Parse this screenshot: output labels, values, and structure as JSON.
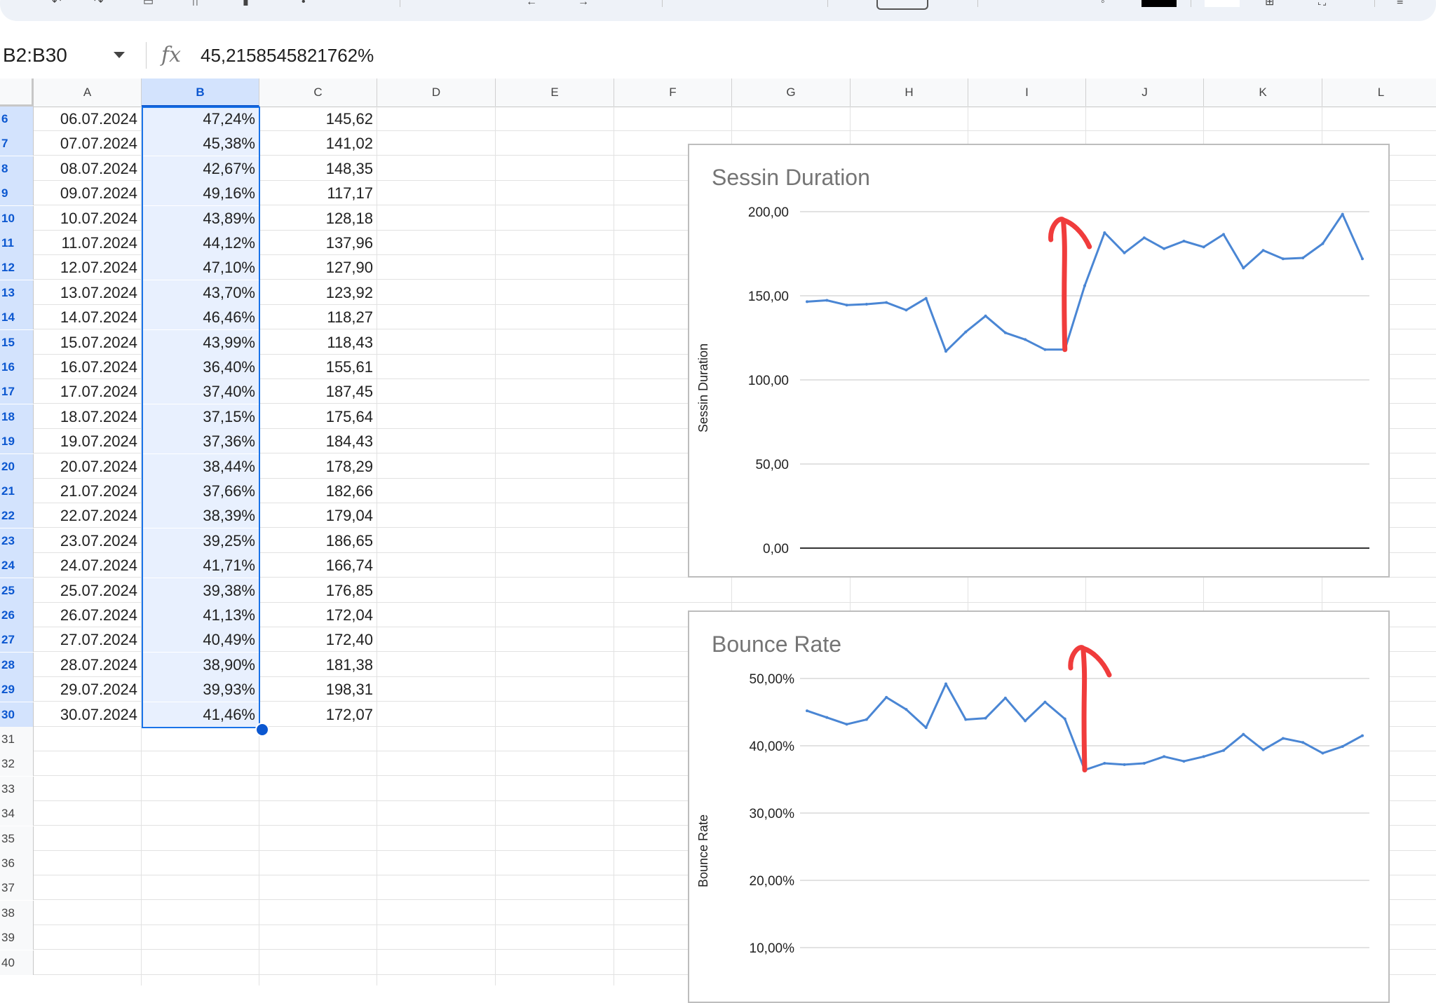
{
  "toolbar": {
    "icons": [
      "undo-icon",
      "redo-icon",
      "print-icon",
      "paint-format-icon",
      "zoom-icon",
      "borders-icon",
      "merge-icon"
    ]
  },
  "formula_bar": {
    "name_box": "B2:B30",
    "fx_label": "fx",
    "value": "45,2158545821762%"
  },
  "columns": [
    "A",
    "B",
    "C",
    "D",
    "E",
    "F",
    "G",
    "H",
    "I",
    "J",
    "K",
    "L"
  ],
  "rows": [
    {
      "num": "6",
      "a": "06.07.2024",
      "b": "47,24%",
      "c": "145,62"
    },
    {
      "num": "7",
      "a": "07.07.2024",
      "b": "45,38%",
      "c": "141,02"
    },
    {
      "num": "8",
      "a": "08.07.2024",
      "b": "42,67%",
      "c": "148,35"
    },
    {
      "num": "9",
      "a": "09.07.2024",
      "b": "49,16%",
      "c": "117,17"
    },
    {
      "num": "10",
      "a": "10.07.2024",
      "b": "43,89%",
      "c": "128,18"
    },
    {
      "num": "11",
      "a": "11.07.2024",
      "b": "44,12%",
      "c": "137,96"
    },
    {
      "num": "12",
      "a": "12.07.2024",
      "b": "47,10%",
      "c": "127,90"
    },
    {
      "num": "13",
      "a": "13.07.2024",
      "b": "43,70%",
      "c": "123,92"
    },
    {
      "num": "14",
      "a": "14.07.2024",
      "b": "46,46%",
      "c": "118,27"
    },
    {
      "num": "15",
      "a": "15.07.2024",
      "b": "43,99%",
      "c": "118,43"
    },
    {
      "num": "16",
      "a": "16.07.2024",
      "b": "36,40%",
      "c": "155,61"
    },
    {
      "num": "17",
      "a": "17.07.2024",
      "b": "37,40%",
      "c": "187,45"
    },
    {
      "num": "18",
      "a": "18.07.2024",
      "b": "37,15%",
      "c": "175,64"
    },
    {
      "num": "19",
      "a": "19.07.2024",
      "b": "37,36%",
      "c": "184,43"
    },
    {
      "num": "20",
      "a": "20.07.2024",
      "b": "38,44%",
      "c": "178,29"
    },
    {
      "num": "21",
      "a": "21.07.2024",
      "b": "37,66%",
      "c": "182,66"
    },
    {
      "num": "22",
      "a": "22.07.2024",
      "b": "38,39%",
      "c": "179,04"
    },
    {
      "num": "23",
      "a": "23.07.2024",
      "b": "39,25%",
      "c": "186,65"
    },
    {
      "num": "24",
      "a": "24.07.2024",
      "b": "41,71%",
      "c": "166,74"
    },
    {
      "num": "25",
      "a": "25.07.2024",
      "b": "39,38%",
      "c": "176,85"
    },
    {
      "num": "26",
      "a": "26.07.2024",
      "b": "41,13%",
      "c": "172,04"
    },
    {
      "num": "27",
      "a": "27.07.2024",
      "b": "40,49%",
      "c": "172,40"
    },
    {
      "num": "28",
      "a": "28.07.2024",
      "b": "38,90%",
      "c": "181,38"
    },
    {
      "num": "29",
      "a": "29.07.2024",
      "b": "39,93%",
      "c": "198,31"
    },
    {
      "num": "30",
      "a": "30.07.2024",
      "b": "41,46%",
      "c": "172,07"
    },
    {
      "num": "31",
      "a": "",
      "b": "",
      "c": ""
    },
    {
      "num": "32",
      "a": "",
      "b": "",
      "c": ""
    },
    {
      "num": "33",
      "a": "",
      "b": "",
      "c": ""
    },
    {
      "num": "34",
      "a": "",
      "b": "",
      "c": ""
    },
    {
      "num": "35",
      "a": "",
      "b": "",
      "c": ""
    },
    {
      "num": "36",
      "a": "",
      "b": "",
      "c": ""
    },
    {
      "num": "37",
      "a": "",
      "b": "",
      "c": ""
    },
    {
      "num": "38",
      "a": "",
      "b": "",
      "c": ""
    },
    {
      "num": "39",
      "a": "",
      "b": "",
      "c": ""
    },
    {
      "num": "40",
      "a": "",
      "b": "",
      "c": ""
    }
  ],
  "chart_data": [
    {
      "type": "line",
      "title": "Sessin Duration",
      "ylabel": "Sessin Duration",
      "ylim": [
        0,
        200
      ],
      "yticks": [
        "200,00",
        "150,00",
        "100,00",
        "50,00",
        "0,00"
      ],
      "ytick_values": [
        200,
        150,
        100,
        50,
        0
      ],
      "series_color": "#4a86d4",
      "values": [
        146.5,
        147.3,
        144.5,
        145.0,
        146.0,
        141.5,
        148.5,
        117.0,
        128.5,
        138.0,
        128.0,
        124.0,
        118.0,
        118.0,
        156.0,
        187.5,
        175.5,
        184.5,
        178.0,
        182.5,
        179.0,
        186.5,
        166.5,
        177.0,
        172.0,
        172.5,
        181.0,
        198.5,
        172.0
      ],
      "annotation": {
        "type": "arrow",
        "color": "#f03c3c",
        "at_index": 13
      }
    },
    {
      "type": "line",
      "title": "Bounce Rate",
      "ylabel": "Bounce Rate",
      "ylim": [
        0,
        50
      ],
      "yticks": [
        "50,00%",
        "40,00%",
        "30,00%",
        "20,00%",
        "10,00%"
      ],
      "ytick_values": [
        50,
        40,
        30,
        20,
        10
      ],
      "series_color": "#4a86d4",
      "values": [
        45.2,
        44.2,
        43.2,
        43.9,
        47.2,
        45.4,
        42.7,
        49.2,
        43.9,
        44.1,
        47.1,
        43.7,
        46.5,
        44.0,
        36.4,
        37.4,
        37.2,
        37.4,
        38.4,
        37.7,
        38.4,
        39.3,
        41.7,
        39.4,
        41.1,
        40.5,
        38.9,
        39.9,
        41.5
      ],
      "annotation": {
        "type": "arrow",
        "color": "#f03c3c",
        "at_index": 14
      }
    }
  ]
}
